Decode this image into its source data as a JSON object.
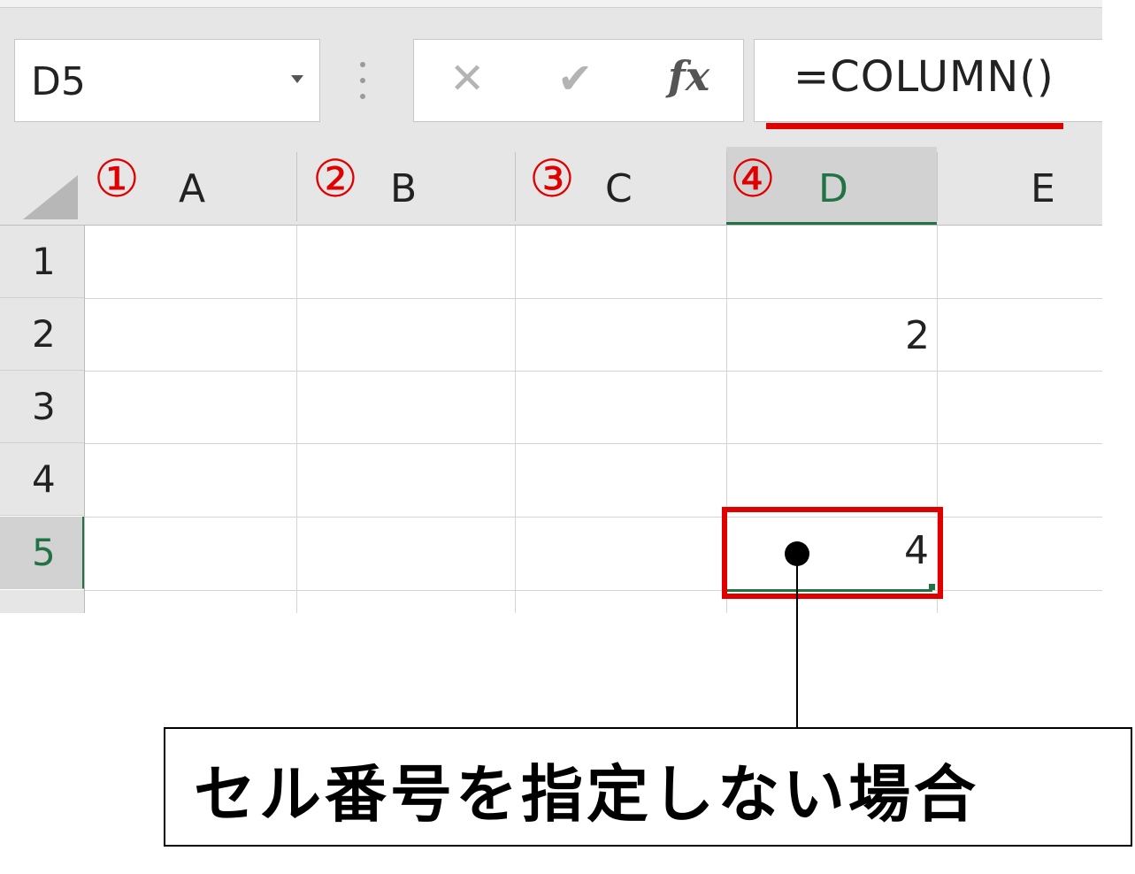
{
  "name_box": {
    "value": "D5"
  },
  "formula_bar": {
    "cancel_glyph": "✕",
    "enter_glyph": "✔",
    "fx_label": "fx",
    "formula": "=COLUMN()"
  },
  "columns": [
    {
      "letter": "A",
      "annotation": "①"
    },
    {
      "letter": "B",
      "annotation": "②"
    },
    {
      "letter": "C",
      "annotation": "③"
    },
    {
      "letter": "D",
      "annotation": "④"
    },
    {
      "letter": "E",
      "annotation": ""
    }
  ],
  "rows": [
    "1",
    "2",
    "3",
    "4",
    "5"
  ],
  "cells": {
    "D2": "2",
    "D5": "4"
  },
  "selected_cell": "D5",
  "callout": {
    "text": "セル番号を指定しない場合"
  },
  "colors": {
    "annotation_red": "#e00000",
    "excel_green": "#217346"
  }
}
